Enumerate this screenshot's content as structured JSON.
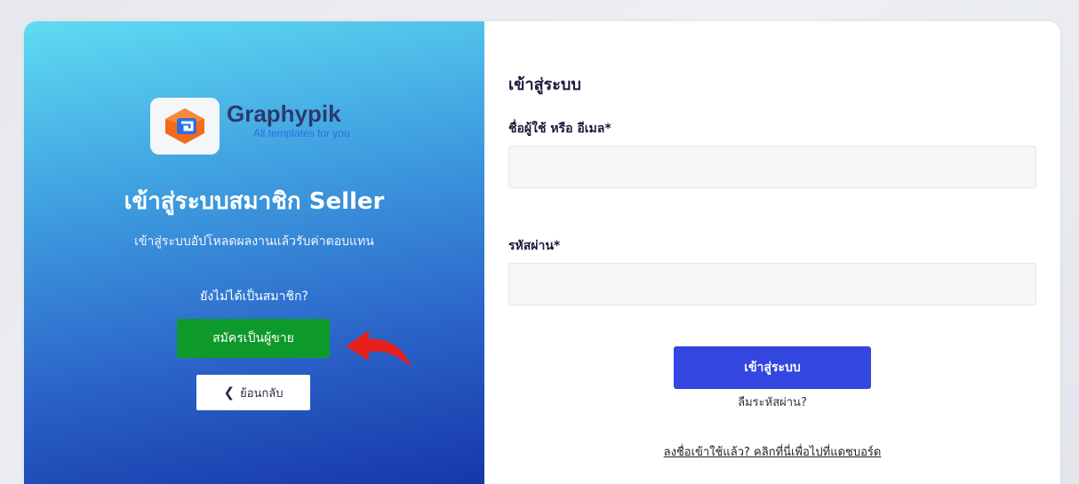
{
  "brand": {
    "name": "Graphypik",
    "tagline": "All templates for you"
  },
  "left": {
    "title": "เข้าสู่ระบบสมาชิก Seller",
    "subtitle": "เข้าสู่ระบบอัปโหลดผลงานแล้วรับค่าตอบแทน",
    "not_member_text": "ยังไม่ได้เป็นสมาชิก?",
    "register_label": "สมัครเป็นผู้ขาย",
    "back_label": "ย้อนกลับ"
  },
  "form": {
    "title": "เข้าสู่ระบบ",
    "username_label": "ชื่อผู้ใช้ หรือ อีเมล*",
    "username_value": "",
    "password_label": "รหัสผ่าน*",
    "password_value": "",
    "login_label": "เข้าสู่ระบบ",
    "forgot_label": "ลืมระหัสผ่าน?",
    "dashboard_link": "ลงชื่อเข้าใช้แล้ว? คลิกที่นี่เพื่อไปที่แดชบอร์ด"
  },
  "colors": {
    "register_button": "#0e9a2a",
    "login_button": "#3346e0",
    "arrow": "#e8201c",
    "panel_gradient_start": "#5fdcf2",
    "panel_gradient_end": "#1637a8"
  },
  "icons": {
    "back": "chevron-left-icon",
    "logo": "graphypik-logo-icon",
    "annotation": "curved-arrow-icon"
  }
}
